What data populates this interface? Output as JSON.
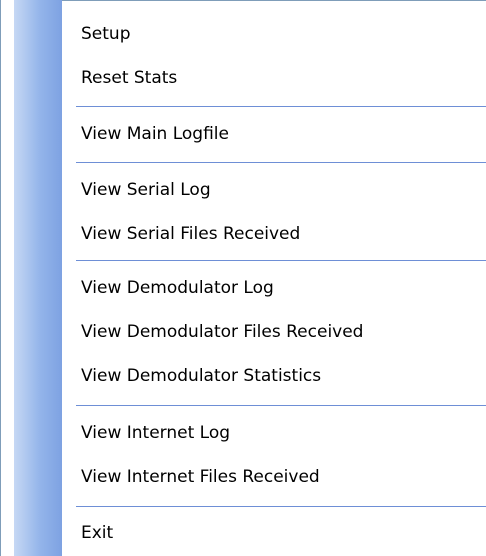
{
  "menu": {
    "items": [
      {
        "label": "Setup"
      },
      {
        "label": "Reset Stats"
      },
      {
        "label": "View Main Logfile"
      },
      {
        "label": "View Serial Log"
      },
      {
        "label": "View Serial Files Received"
      },
      {
        "label": "View Demodulator Log"
      },
      {
        "label": "View Demodulator Files Received"
      },
      {
        "label": "View Demodulator Statistics"
      },
      {
        "label": "View Internet Log"
      },
      {
        "label": "View Internet Files Received"
      },
      {
        "label": "Exit"
      }
    ]
  },
  "colors": {
    "gutter_light": "#c6d8f4",
    "gutter_dark": "#7ea2e2",
    "separator": "#6e8fd6",
    "border": "#7f9db9",
    "background": "#ffffff",
    "text": "#000000"
  }
}
